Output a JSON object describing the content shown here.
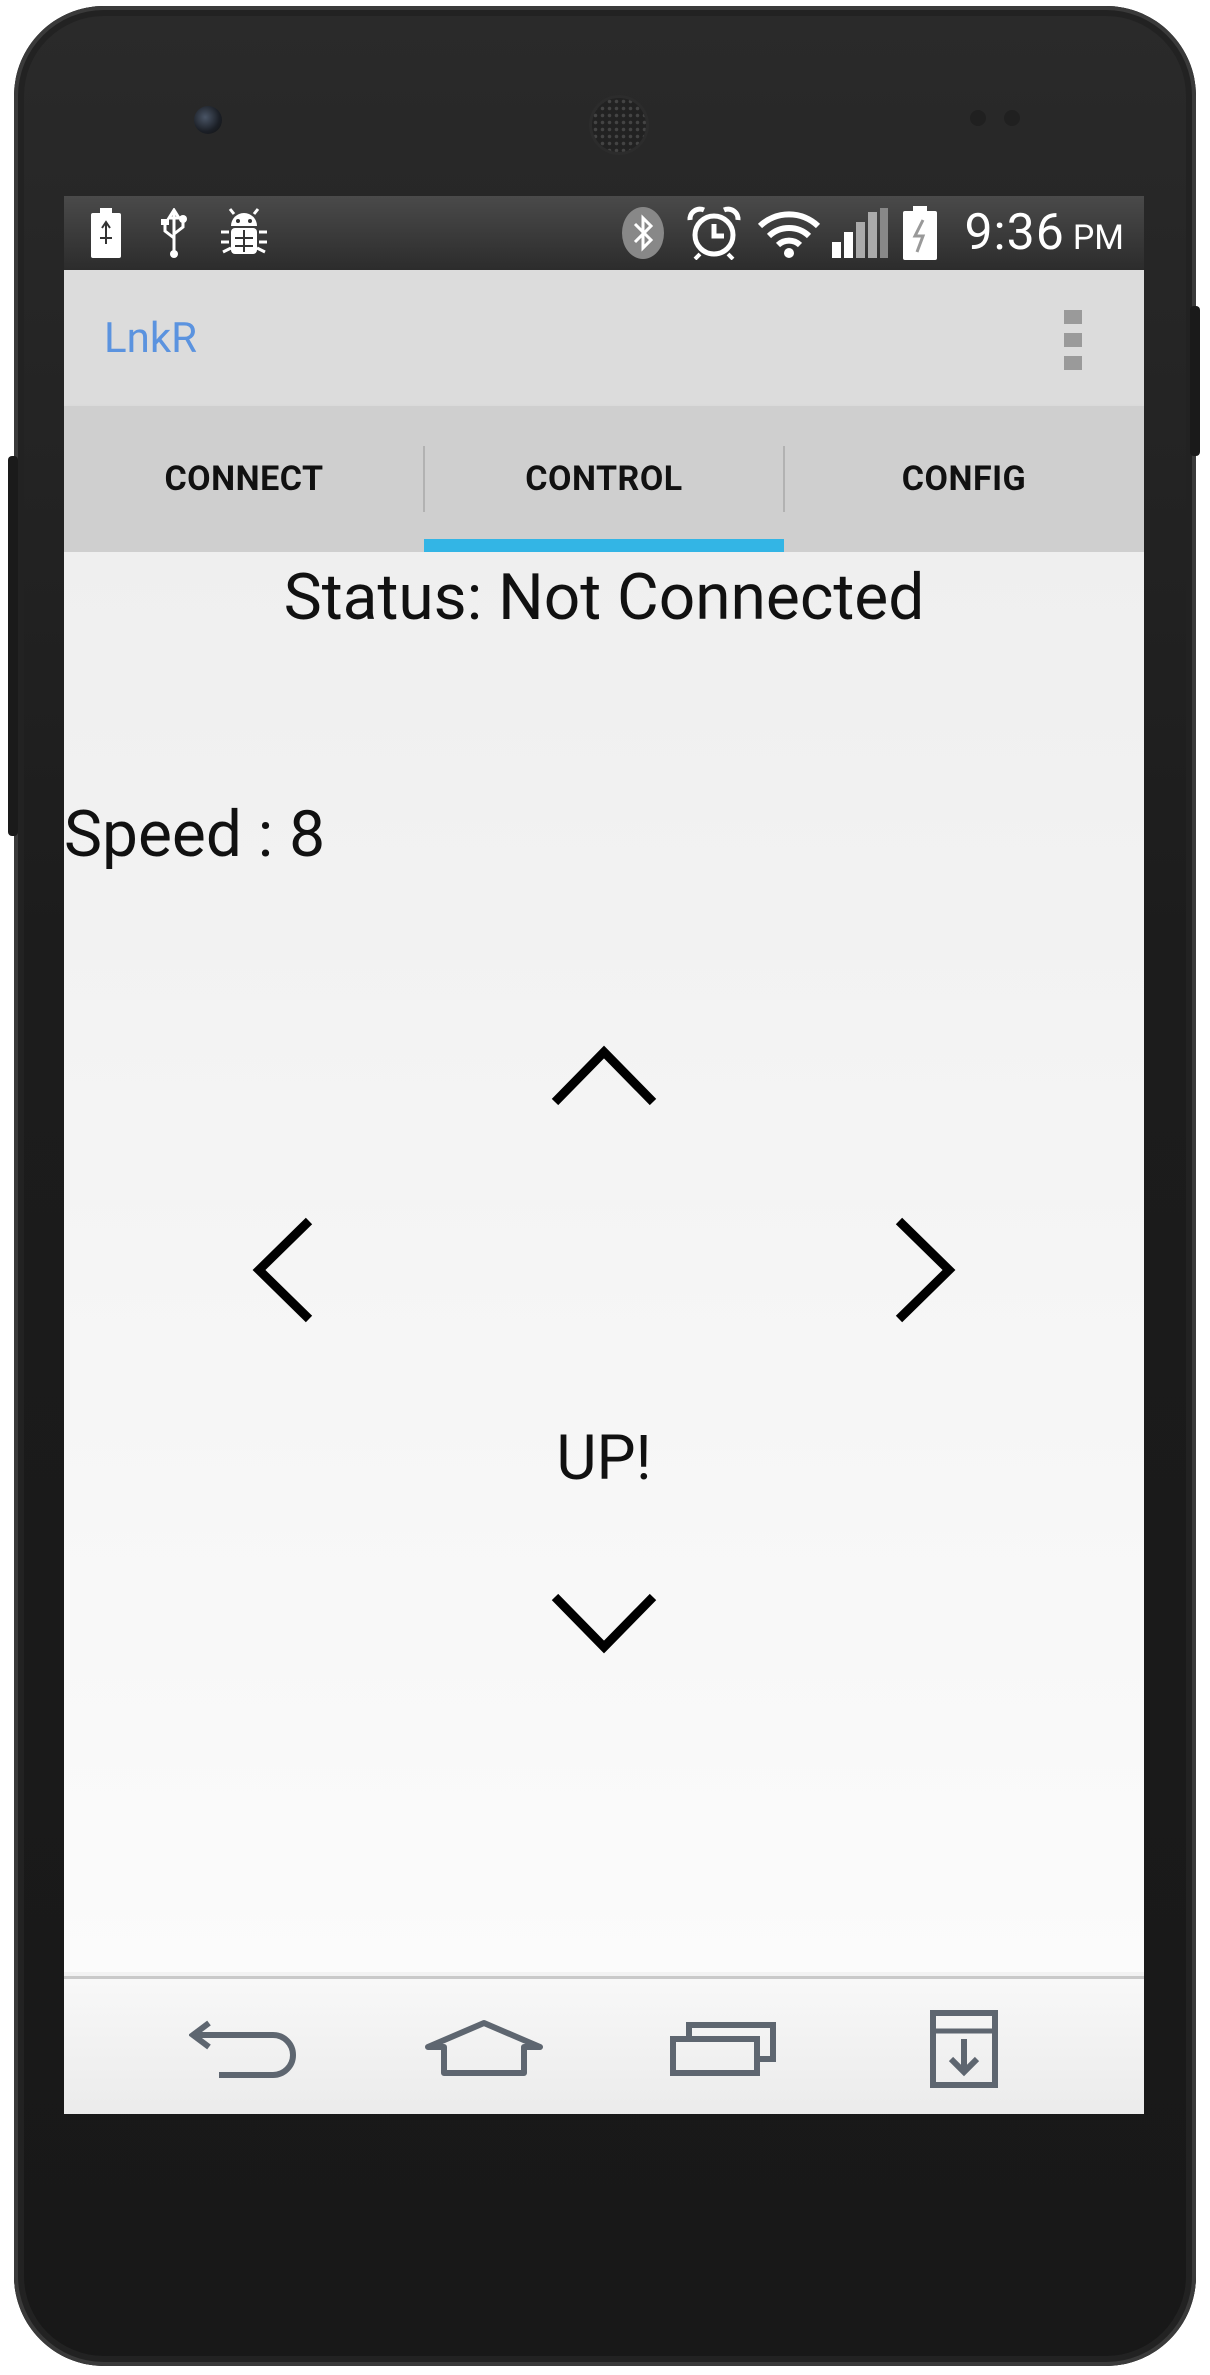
{
  "status_bar": {
    "time": "9:36",
    "ampm": "PM",
    "left_icons": [
      "battery-full-icon",
      "usb-icon",
      "android-debug-icon"
    ],
    "right_icons": [
      "bluetooth-icon",
      "alarm-icon",
      "wifi-icon",
      "signal-icon",
      "battery-charging-icon"
    ]
  },
  "action_bar": {
    "title": "LnkR",
    "title_color": "#5b93df",
    "overflow_icon": "overflow-menu-icon"
  },
  "tabs": {
    "items": [
      {
        "label": "CONNECT",
        "selected": false
      },
      {
        "label": "CONTROL",
        "selected": true
      },
      {
        "label": "CONFIG",
        "selected": false
      }
    ],
    "indicator_color": "#33b5e5"
  },
  "control": {
    "status": "Status: Not Connected",
    "speed": "Speed : 8",
    "direction_label": "UP!",
    "buttons": [
      "chevron-up-icon",
      "chevron-left-icon",
      "chevron-right-icon",
      "chevron-down-icon"
    ]
  },
  "nav_bar": {
    "icons": [
      "back-icon",
      "home-icon",
      "recent-apps-icon",
      "download-icon"
    ]
  }
}
